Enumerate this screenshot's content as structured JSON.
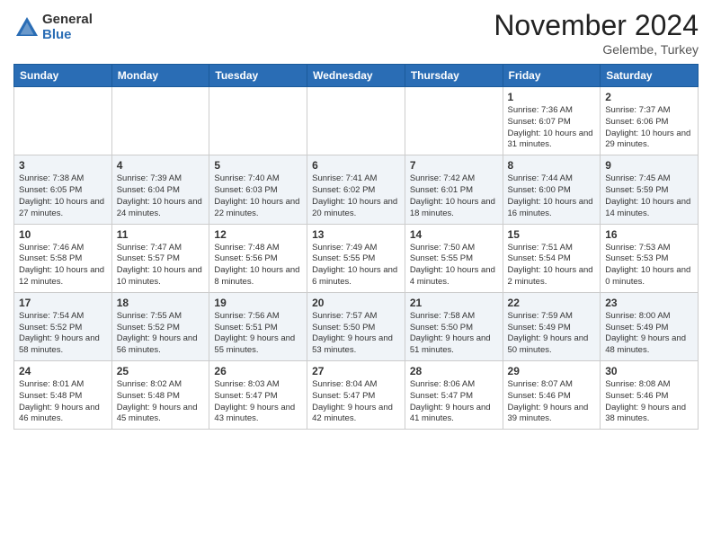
{
  "header": {
    "logo_general": "General",
    "logo_blue": "Blue",
    "month_title": "November 2024",
    "location": "Gelembe, Turkey"
  },
  "weekdays": [
    "Sunday",
    "Monday",
    "Tuesday",
    "Wednesday",
    "Thursday",
    "Friday",
    "Saturday"
  ],
  "weeks": [
    [
      {
        "day": "",
        "info": ""
      },
      {
        "day": "",
        "info": ""
      },
      {
        "day": "",
        "info": ""
      },
      {
        "day": "",
        "info": ""
      },
      {
        "day": "",
        "info": ""
      },
      {
        "day": "1",
        "info": "Sunrise: 7:36 AM\nSunset: 6:07 PM\nDaylight: 10 hours and 31 minutes."
      },
      {
        "day": "2",
        "info": "Sunrise: 7:37 AM\nSunset: 6:06 PM\nDaylight: 10 hours and 29 minutes."
      }
    ],
    [
      {
        "day": "3",
        "info": "Sunrise: 7:38 AM\nSunset: 6:05 PM\nDaylight: 10 hours and 27 minutes."
      },
      {
        "day": "4",
        "info": "Sunrise: 7:39 AM\nSunset: 6:04 PM\nDaylight: 10 hours and 24 minutes."
      },
      {
        "day": "5",
        "info": "Sunrise: 7:40 AM\nSunset: 6:03 PM\nDaylight: 10 hours and 22 minutes."
      },
      {
        "day": "6",
        "info": "Sunrise: 7:41 AM\nSunset: 6:02 PM\nDaylight: 10 hours and 20 minutes."
      },
      {
        "day": "7",
        "info": "Sunrise: 7:42 AM\nSunset: 6:01 PM\nDaylight: 10 hours and 18 minutes."
      },
      {
        "day": "8",
        "info": "Sunrise: 7:44 AM\nSunset: 6:00 PM\nDaylight: 10 hours and 16 minutes."
      },
      {
        "day": "9",
        "info": "Sunrise: 7:45 AM\nSunset: 5:59 PM\nDaylight: 10 hours and 14 minutes."
      }
    ],
    [
      {
        "day": "10",
        "info": "Sunrise: 7:46 AM\nSunset: 5:58 PM\nDaylight: 10 hours and 12 minutes."
      },
      {
        "day": "11",
        "info": "Sunrise: 7:47 AM\nSunset: 5:57 PM\nDaylight: 10 hours and 10 minutes."
      },
      {
        "day": "12",
        "info": "Sunrise: 7:48 AM\nSunset: 5:56 PM\nDaylight: 10 hours and 8 minutes."
      },
      {
        "day": "13",
        "info": "Sunrise: 7:49 AM\nSunset: 5:55 PM\nDaylight: 10 hours and 6 minutes."
      },
      {
        "day": "14",
        "info": "Sunrise: 7:50 AM\nSunset: 5:55 PM\nDaylight: 10 hours and 4 minutes."
      },
      {
        "day": "15",
        "info": "Sunrise: 7:51 AM\nSunset: 5:54 PM\nDaylight: 10 hours and 2 minutes."
      },
      {
        "day": "16",
        "info": "Sunrise: 7:53 AM\nSunset: 5:53 PM\nDaylight: 10 hours and 0 minutes."
      }
    ],
    [
      {
        "day": "17",
        "info": "Sunrise: 7:54 AM\nSunset: 5:52 PM\nDaylight: 9 hours and 58 minutes."
      },
      {
        "day": "18",
        "info": "Sunrise: 7:55 AM\nSunset: 5:52 PM\nDaylight: 9 hours and 56 minutes."
      },
      {
        "day": "19",
        "info": "Sunrise: 7:56 AM\nSunset: 5:51 PM\nDaylight: 9 hours and 55 minutes."
      },
      {
        "day": "20",
        "info": "Sunrise: 7:57 AM\nSunset: 5:50 PM\nDaylight: 9 hours and 53 minutes."
      },
      {
        "day": "21",
        "info": "Sunrise: 7:58 AM\nSunset: 5:50 PM\nDaylight: 9 hours and 51 minutes."
      },
      {
        "day": "22",
        "info": "Sunrise: 7:59 AM\nSunset: 5:49 PM\nDaylight: 9 hours and 50 minutes."
      },
      {
        "day": "23",
        "info": "Sunrise: 8:00 AM\nSunset: 5:49 PM\nDaylight: 9 hours and 48 minutes."
      }
    ],
    [
      {
        "day": "24",
        "info": "Sunrise: 8:01 AM\nSunset: 5:48 PM\nDaylight: 9 hours and 46 minutes."
      },
      {
        "day": "25",
        "info": "Sunrise: 8:02 AM\nSunset: 5:48 PM\nDaylight: 9 hours and 45 minutes."
      },
      {
        "day": "26",
        "info": "Sunrise: 8:03 AM\nSunset: 5:47 PM\nDaylight: 9 hours and 43 minutes."
      },
      {
        "day": "27",
        "info": "Sunrise: 8:04 AM\nSunset: 5:47 PM\nDaylight: 9 hours and 42 minutes."
      },
      {
        "day": "28",
        "info": "Sunrise: 8:06 AM\nSunset: 5:47 PM\nDaylight: 9 hours and 41 minutes."
      },
      {
        "day": "29",
        "info": "Sunrise: 8:07 AM\nSunset: 5:46 PM\nDaylight: 9 hours and 39 minutes."
      },
      {
        "day": "30",
        "info": "Sunrise: 8:08 AM\nSunset: 5:46 PM\nDaylight: 9 hours and 38 minutes."
      }
    ]
  ]
}
